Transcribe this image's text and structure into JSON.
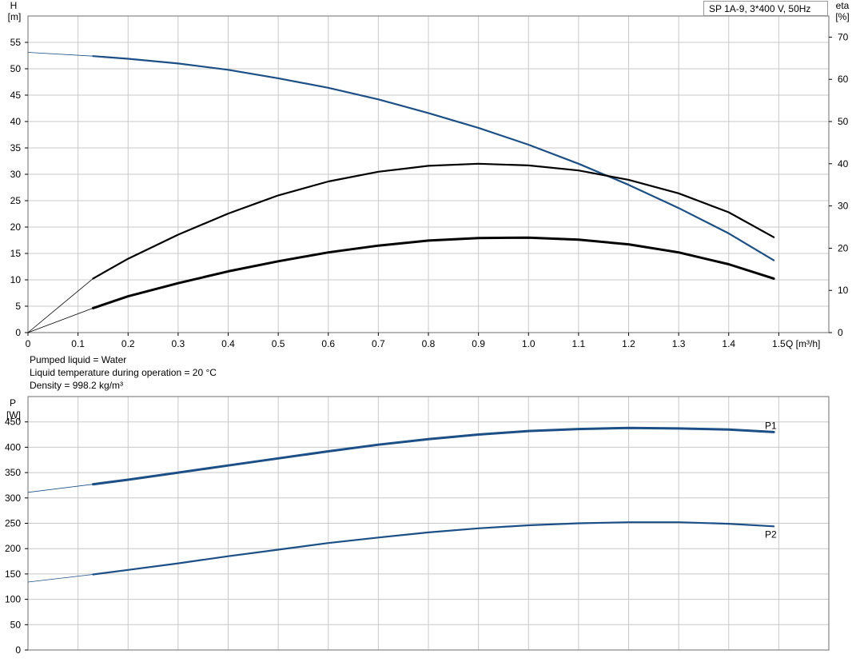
{
  "legend_label": "SP 1A-9, 3*400 V, 50Hz",
  "info": [
    "Pumped liquid = Water",
    "Liquid temperature during operation = 20 °C",
    "Density = 998.2 kg/m³"
  ],
  "colors": {
    "curve_blue": "#1b4f86",
    "curve_black": "#000000",
    "grid": "#c8c8c8",
    "frame": "#6e6e6e"
  },
  "chart_data": [
    {
      "type": "line",
      "title": "",
      "xlabel": "Q [m³/h]",
      "ylabel_left_top": "H",
      "ylabel_left_unit": "[m]",
      "ylabel_right_top": "eta",
      "ylabel_right_unit": "[%]",
      "xlim": [
        0,
        1.5
      ],
      "ylim_left": [
        0,
        55
      ],
      "ylim_right": [
        0,
        70
      ],
      "x_ticks": [
        "0",
        "0.1",
        "0.2",
        "0.3",
        "0.4",
        "0.5",
        "0.6",
        "0.7",
        "0.8",
        "0.9",
        "1.0",
        "1.1",
        "1.2",
        "1.3",
        "1.4",
        "1.5"
      ],
      "y_ticks_left": [
        "0",
        "5",
        "10",
        "15",
        "20",
        "25",
        "30",
        "35",
        "40",
        "45",
        "50",
        "55"
      ],
      "y_ticks_right": [
        "0",
        "10",
        "20",
        "30",
        "40",
        "50",
        "60",
        "70"
      ],
      "grid": true,
      "series": [
        {
          "axis": "left",
          "color": "#1b4f86",
          "x": [
            0,
            0.13,
            0.2,
            0.3,
            0.4,
            0.5,
            0.6,
            0.7,
            0.8,
            0.9,
            1.0,
            1.1,
            1.2,
            1.3,
            1.4,
            1.49
          ],
          "y": [
            53.1,
            52.4,
            51.9,
            51.0,
            49.8,
            48.2,
            46.4,
            44.2,
            41.6,
            38.8,
            35.6,
            32.0,
            28.0,
            23.6,
            18.8,
            13.7
          ],
          "thin_until": 0.13
        },
        {
          "axis": "right",
          "color": "#000000",
          "x": [
            0,
            0.13,
            0.2,
            0.3,
            0.4,
            0.5,
            0.6,
            0.7,
            0.8,
            0.9,
            1.0,
            1.1,
            1.2,
            1.3,
            1.4,
            1.49
          ],
          "y": [
            0,
            12.8,
            17.5,
            23.2,
            28.2,
            32.5,
            35.8,
            38.1,
            39.5,
            40.0,
            39.6,
            38.4,
            36.2,
            33.0,
            28.5,
            22.6
          ],
          "thin_until": 0.13
        },
        {
          "axis": "right",
          "color": "#000000",
          "x": [
            0,
            0.13,
            0.2,
            0.3,
            0.4,
            0.5,
            0.6,
            0.7,
            0.8,
            0.9,
            1.0,
            1.1,
            1.2,
            1.3,
            1.4,
            1.49
          ],
          "y": [
            0,
            5.8,
            8.6,
            11.7,
            14.5,
            16.9,
            19.0,
            20.6,
            21.8,
            22.4,
            22.5,
            22.0,
            20.9,
            19.0,
            16.2,
            12.8
          ],
          "thin_until": 0.13,
          "bold": true
        }
      ]
    },
    {
      "type": "line",
      "title": "",
      "xlabel": "",
      "ylabel_left_top": "P",
      "ylabel_left_unit": "[W]",
      "xlim": [
        0,
        1.5
      ],
      "ylim": [
        0,
        450
      ],
      "y_ticks": [
        "0",
        "50",
        "100",
        "150",
        "200",
        "250",
        "300",
        "350",
        "400",
        "450"
      ],
      "grid": true,
      "series": [
        {
          "name": "P1",
          "color": "#1b4f86",
          "x": [
            0,
            0.13,
            0.2,
            0.3,
            0.4,
            0.5,
            0.6,
            0.7,
            0.8,
            0.9,
            1.0,
            1.1,
            1.2,
            1.3,
            1.4,
            1.49
          ],
          "y": [
            311,
            327,
            336,
            350,
            364,
            378,
            392,
            405,
            416,
            425,
            432,
            436,
            438,
            437,
            435,
            430
          ],
          "thin_until": 0.13,
          "bold": true
        },
        {
          "name": "P2",
          "color": "#1b4f86",
          "x": [
            0,
            0.13,
            0.2,
            0.3,
            0.4,
            0.5,
            0.6,
            0.7,
            0.8,
            0.9,
            1.0,
            1.1,
            1.2,
            1.3,
            1.4,
            1.49
          ],
          "y": [
            134,
            149,
            158,
            171,
            185,
            198,
            211,
            222,
            232,
            240,
            246,
            250,
            252,
            252,
            249,
            244
          ],
          "thin_until": 0.13
        }
      ]
    }
  ]
}
